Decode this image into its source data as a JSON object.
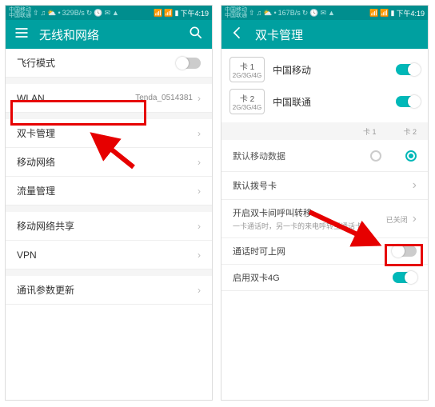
{
  "status": {
    "carrier_lines": "中国移动\n中国联通",
    "net_speed_left": "329B/s",
    "net_speed_right": "167B/s",
    "time": "下午4:19"
  },
  "left": {
    "title": "无线和网络",
    "rows": {
      "airplane": "飞行模式",
      "wlan": "WLAN",
      "wlan_sub": "Tenda_0514381",
      "dualsim": "双卡管理",
      "mobile": "移动网络",
      "traffic": "流量管理",
      "tether": "移动网络共享",
      "vpn": "VPN",
      "comm": "通讯参数更新"
    }
  },
  "right": {
    "title": "双卡管理",
    "sim1": {
      "slot": "卡 1",
      "net": "2G/3G/4G",
      "carrier": "中国移动"
    },
    "sim2": {
      "slot": "卡 2",
      "net": "2G/3G/4G",
      "carrier": "中国联通"
    },
    "radio_head_a": "卡 1",
    "radio_head_b": "卡 2",
    "default_data": "默认移动数据",
    "default_call": "默认拨号卡",
    "forward_t1": "开启双卡间呼叫转移",
    "forward_t2": "一卡通话时，另一卡的来电呼转至通话卡",
    "forward_state": "已关闭",
    "data_during_call": "通话时可上网",
    "enable_dual4g": "启用双卡4G"
  }
}
